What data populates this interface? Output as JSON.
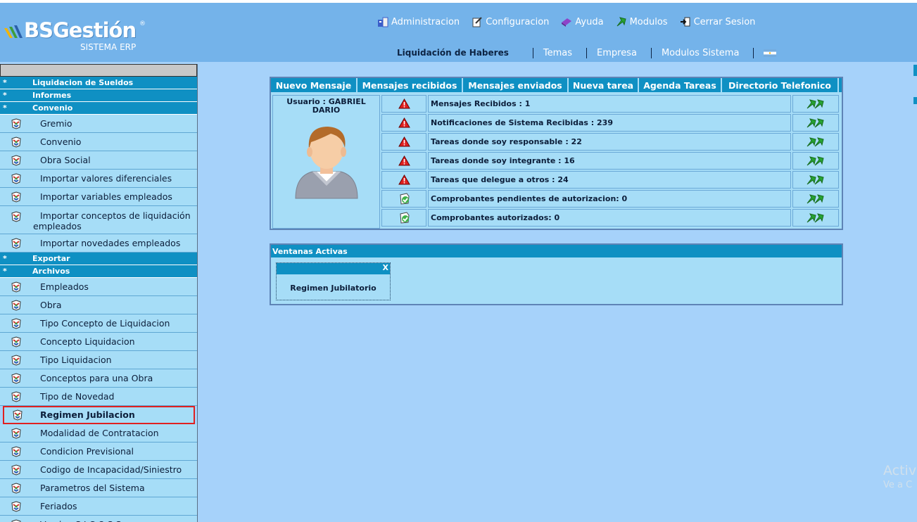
{
  "brand": {
    "name": "BSGestión",
    "reg": "®",
    "subtitle": "SISTEMA ERP"
  },
  "topnav": [
    {
      "label": "Administracion",
      "icon": "admin-icon"
    },
    {
      "label": "Configuracion",
      "icon": "config-icon"
    },
    {
      "label": "Ayuda",
      "icon": "help-icon"
    },
    {
      "label": "Modulos",
      "icon": "modules-icon"
    },
    {
      "label": "Cerrar Sesion",
      "icon": "logout-icon"
    }
  ],
  "subnav": {
    "title": "Liquidación de Haberes",
    "links": [
      "Temas",
      "Empresa",
      "Modulos Sistema"
    ]
  },
  "sidebar": {
    "sections": [
      {
        "star": "*",
        "label": "Liquidacion de Sueldos",
        "items": []
      },
      {
        "star": "*",
        "label": "Informes",
        "items": []
      },
      {
        "star": "*",
        "label": "Convenio",
        "items": [
          "Gremio",
          "Convenio",
          "Obra Social",
          "Importar valores diferenciales",
          "Importar variables empleados",
          "Importar conceptos de liquidación empleados",
          "Importar novedades empleados"
        ]
      },
      {
        "star": "*",
        "label": "Exportar",
        "items": []
      },
      {
        "star": "*",
        "label": "Archivos",
        "items": [
          "Empleados",
          "Obra",
          "Tipo Concepto de Liquidacion",
          "Concepto Liquidacion",
          "Tipo Liquidacion",
          "Conceptos para una Obra",
          "Tipo de Novedad",
          "Regimen Jubilacion",
          "Modalidad de Contratacion",
          "Condicion Previsional",
          "Codigo de Incapacidad/Siniestro",
          "Parametros del Sistema",
          "Feriados",
          "Version S.I.C.O.S.S."
        ]
      }
    ],
    "tall_item_parts": [
      "Importar conceptos de liquidación",
      "empleados"
    ],
    "active_item": "Regimen Jubilacion"
  },
  "tabs": [
    "Nuevo Mensaje",
    "Mensajes recibidos",
    "Mensajes enviados",
    "Nueva tarea",
    "Agenda Tareas",
    "Directorio Telefonico"
  ],
  "user": {
    "label": "Usuario : GABRIEL DARIO"
  },
  "notifications": [
    {
      "type": "warning",
      "text": "Mensajes Recibidos : 1"
    },
    {
      "type": "warning",
      "text": "Notificaciones de Sistema Recibidas : 239"
    },
    {
      "type": "warning",
      "text": "Tareas donde soy responsable : 22"
    },
    {
      "type": "warning",
      "text": "Tareas donde soy integrante : 16"
    },
    {
      "type": "warning",
      "text": "Tareas que delegue a otros : 24"
    },
    {
      "type": "ok",
      "text": "Comprobantes pendientes de autorizacion: 0"
    },
    {
      "type": "ok",
      "text": "Comprobantes autorizados: 0"
    }
  ],
  "ventanas": {
    "title": "Ventanas Activas",
    "close": "X",
    "window_title": "Regimen Jubilatorio"
  },
  "watermark": {
    "line1": "Activ",
    "line2": "Ve a C"
  },
  "colors": {
    "header": "#74b3ea",
    "accent": "#0f90c3",
    "panel": "#a6ddf7",
    "background": "#a6d2fa",
    "active_outline": "#e02020"
  }
}
